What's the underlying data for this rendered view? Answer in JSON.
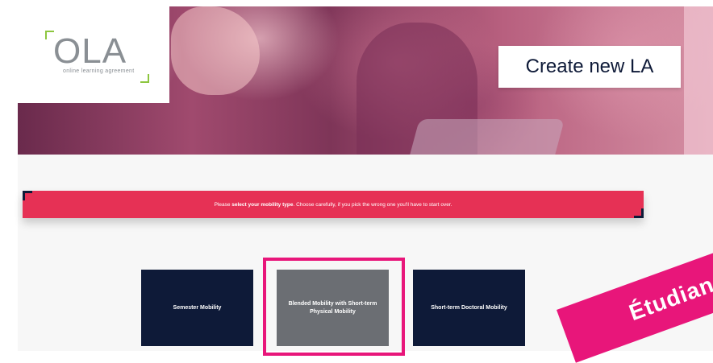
{
  "logo": {
    "name": "OLA",
    "subtitle": "online learning agreement"
  },
  "header": {
    "create_button_label": "Create new LA"
  },
  "banner": {
    "text_prefix": "Please ",
    "text_bold": "select your mobility type",
    "text_suffix": ". Choose carefully, if you pick the wrong one you'll have to start over."
  },
  "mobility_types": [
    {
      "label": "Semester Mobility",
      "selected": false
    },
    {
      "label": "Blended Mobility with Short-term Physical Mobility",
      "selected": true
    },
    {
      "label": "Short-term Doctoral Mobility",
      "selected": false
    }
  ],
  "ribbon": {
    "text": "Étudian"
  },
  "colors": {
    "navy": "#0e1a38",
    "banner_red": "#e63155",
    "highlight_pink": "#e8167a",
    "selected_gray": "#6b6e73",
    "logo_green": "#8dc63f"
  }
}
